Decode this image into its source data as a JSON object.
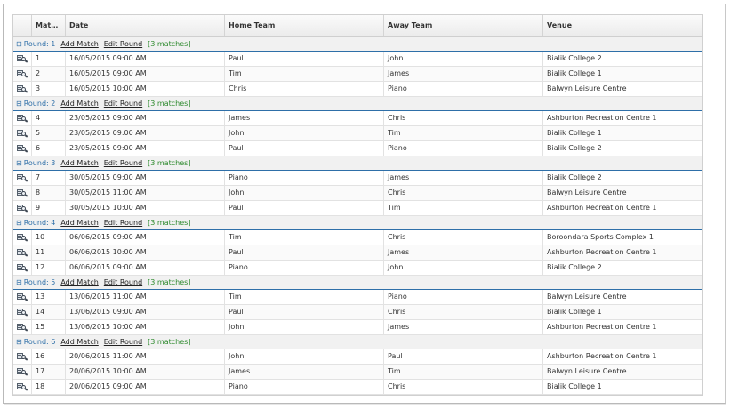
{
  "columns": [
    "",
    "Match ...",
    "Date",
    "Home Team",
    "Away Team",
    "Venue"
  ],
  "group_labels": {
    "add": "Add Match",
    "edit": "Edit Round",
    "toggle": "⊟"
  },
  "rounds": [
    {
      "label": "Round: 1",
      "count": "[3 matches]",
      "matches": [
        {
          "no": "1",
          "date": "16/05/2015 09:00 AM",
          "home": "Paul",
          "away": "John",
          "venue": "Bialik College 2"
        },
        {
          "no": "2",
          "date": "16/05/2015 09:00 AM",
          "home": "Tim",
          "away": "James",
          "venue": "Bialik College 1"
        },
        {
          "no": "3",
          "date": "16/05/2015 10:00 AM",
          "home": "Chris",
          "away": "Piano",
          "venue": "Balwyn Leisure Centre"
        }
      ]
    },
    {
      "label": "Round: 2",
      "count": "[3 matches]",
      "matches": [
        {
          "no": "4",
          "date": "23/05/2015 09:00 AM",
          "home": "James",
          "away": "Chris",
          "venue": "Ashburton Recreation Centre 1"
        },
        {
          "no": "5",
          "date": "23/05/2015 09:00 AM",
          "home": "John",
          "away": "Tim",
          "venue": "Bialik College 1"
        },
        {
          "no": "6",
          "date": "23/05/2015 09:00 AM",
          "home": "Paul",
          "away": "Piano",
          "venue": "Bialik College 2"
        }
      ]
    },
    {
      "label": "Round: 3",
      "count": "[3 matches]",
      "matches": [
        {
          "no": "7",
          "date": "30/05/2015 09:00 AM",
          "home": "Piano",
          "away": "James",
          "venue": "Bialik College 2"
        },
        {
          "no": "8",
          "date": "30/05/2015 11:00 AM",
          "home": "John",
          "away": "Chris",
          "venue": "Balwyn Leisure Centre"
        },
        {
          "no": "9",
          "date": "30/05/2015 10:00 AM",
          "home": "Paul",
          "away": "Tim",
          "venue": "Ashburton Recreation Centre 1"
        }
      ]
    },
    {
      "label": "Round: 4",
      "count": "[3 matches]",
      "matches": [
        {
          "no": "10",
          "date": "06/06/2015 09:00 AM",
          "home": "Tim",
          "away": "Chris",
          "venue": "Boroondara Sports Complex 1"
        },
        {
          "no": "11",
          "date": "06/06/2015 10:00 AM",
          "home": "Paul",
          "away": "James",
          "venue": "Ashburton Recreation Centre 1"
        },
        {
          "no": "12",
          "date": "06/06/2015 09:00 AM",
          "home": "Piano",
          "away": "John",
          "venue": "Bialik College 2"
        }
      ]
    },
    {
      "label": "Round: 5",
      "count": "[3 matches]",
      "matches": [
        {
          "no": "13",
          "date": "13/06/2015 11:00 AM",
          "home": "Tim",
          "away": "Piano",
          "venue": "Balwyn Leisure Centre"
        },
        {
          "no": "14",
          "date": "13/06/2015 09:00 AM",
          "home": "Paul",
          "away": "Chris",
          "venue": "Bialik College 1"
        },
        {
          "no": "15",
          "date": "13/06/2015 10:00 AM",
          "home": "John",
          "away": "James",
          "venue": "Ashburton Recreation Centre 1"
        }
      ]
    },
    {
      "label": "Round: 6",
      "count": "[3 matches]",
      "matches": [
        {
          "no": "16",
          "date": "20/06/2015 11:00 AM",
          "home": "John",
          "away": "Paul",
          "venue": "Ashburton Recreation Centre 1"
        },
        {
          "no": "17",
          "date": "20/06/2015 10:00 AM",
          "home": "James",
          "away": "Tim",
          "venue": "Balwyn Leisure Centre"
        },
        {
          "no": "18",
          "date": "20/06/2015 09:00 AM",
          "home": "Piano",
          "away": "Chris",
          "venue": "Bialik College 1"
        }
      ]
    }
  ],
  "colors": {
    "group_border": "#2e6fa8",
    "round_label": "#2e6fa8",
    "count": "#2e8a2e"
  },
  "row_icon": "view-details-icon"
}
